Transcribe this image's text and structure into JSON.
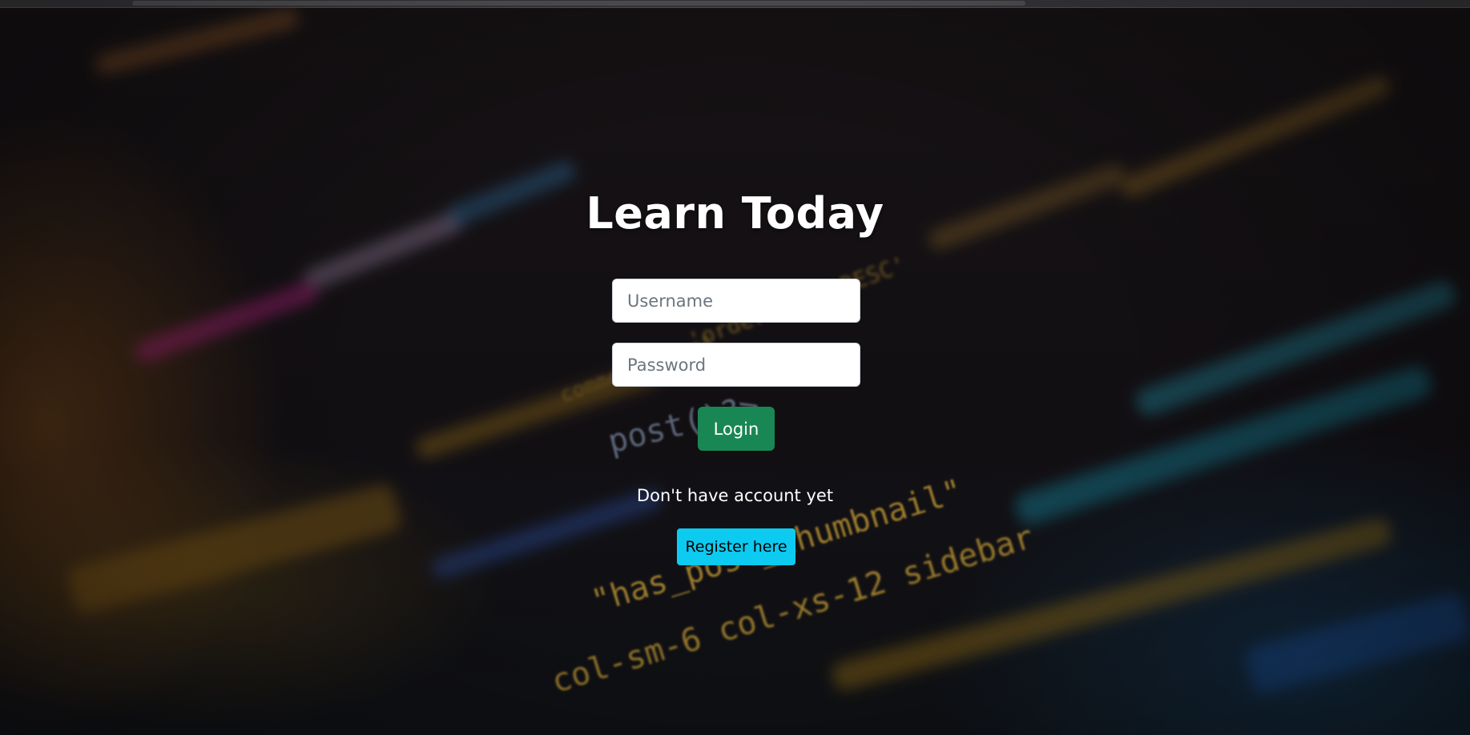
{
  "login": {
    "title": "Learn Today",
    "username_placeholder": "Username",
    "password_placeholder": "Password",
    "login_label": "Login",
    "no_account_text": "Don't have account yet",
    "register_label": "Register here"
  },
  "colors": {
    "login_button": "#198754",
    "register_button": "#0dcaf0",
    "background": "#121014"
  }
}
